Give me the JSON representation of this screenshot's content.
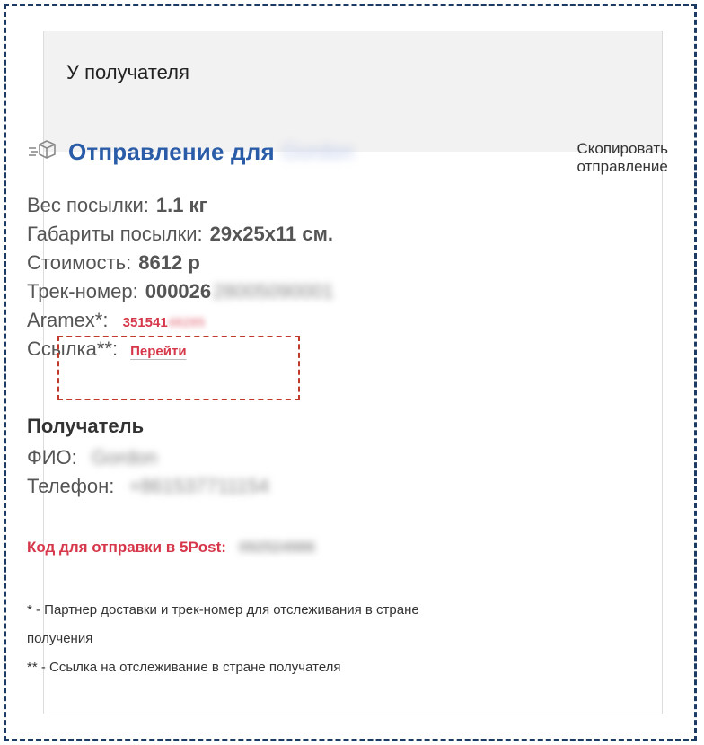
{
  "header": {
    "title": "У получателя"
  },
  "shipment": {
    "title_prefix": "Отправление для",
    "recipient_name_blurred": "Gordon",
    "copy_button": "Скопировать\nотправление"
  },
  "parcel": {
    "weight_label": "Вес посылки:",
    "weight_value": "1.1 кг",
    "dims_label": "Габариты посылки:",
    "dims_value": "29x25x11 см.",
    "cost_label": "Стоимость:",
    "cost_value": "8612 р",
    "track_label": "Трек-номер:",
    "track_value": "000026",
    "track_blurred": "28005090001",
    "aramex_label": "Aramex*:",
    "aramex_value": "351541",
    "aramex_blurred": "48285",
    "link_label": "Ссылка**:",
    "link_text": "Перейти"
  },
  "recipient": {
    "section_title": "Получатель",
    "fio_label": "ФИО:",
    "fio_blurred": "Gordon",
    "phone_label": "Телефон:",
    "phone_blurred": "+861537711154"
  },
  "code5post": {
    "label": "Код для отправки в 5Post:",
    "blurred": "092524986"
  },
  "notes": {
    "note1": "* - Партнер доставки и трек-номер для отслеживания в стране получения",
    "note2": "** - Ссылка на отслеживание в стране получателя"
  },
  "colors": {
    "accent": "#2a5ca8",
    "red": "#d6374a",
    "border": "#1d3a63"
  }
}
